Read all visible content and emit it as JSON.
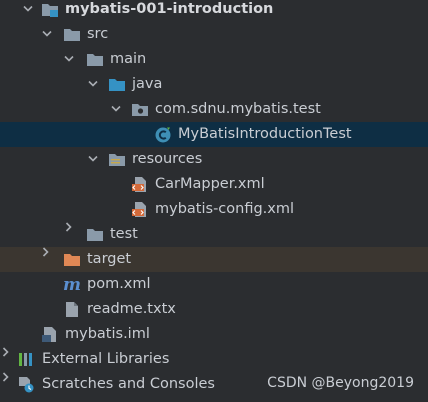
{
  "project_tree": {
    "project_root": "mybatis-001-introduction",
    "src": "src",
    "main": "main",
    "java": "java",
    "package": "com.sdnu.mybatis.test",
    "test_class": "MyBatisIntroductionTest",
    "resources": "resources",
    "car_mapper": "CarMapper.xml",
    "mybatis_config": "mybatis-config.xml",
    "test": "test",
    "target": "target",
    "pom": "pom.xml",
    "readme": "readme.txtx",
    "iml": "mybatis.iml",
    "external_libraries": "External Libraries",
    "scratches": "Scratches and Consoles"
  },
  "watermark": "CSDN @Beyong2019",
  "colors": {
    "background": "#2b2d30",
    "selected_row": "#0e2e44",
    "excluded_row": "#3b3630",
    "folder": "#8a9aa9",
    "source_folder": "#3592c4",
    "excluded_folder": "#e08855"
  }
}
